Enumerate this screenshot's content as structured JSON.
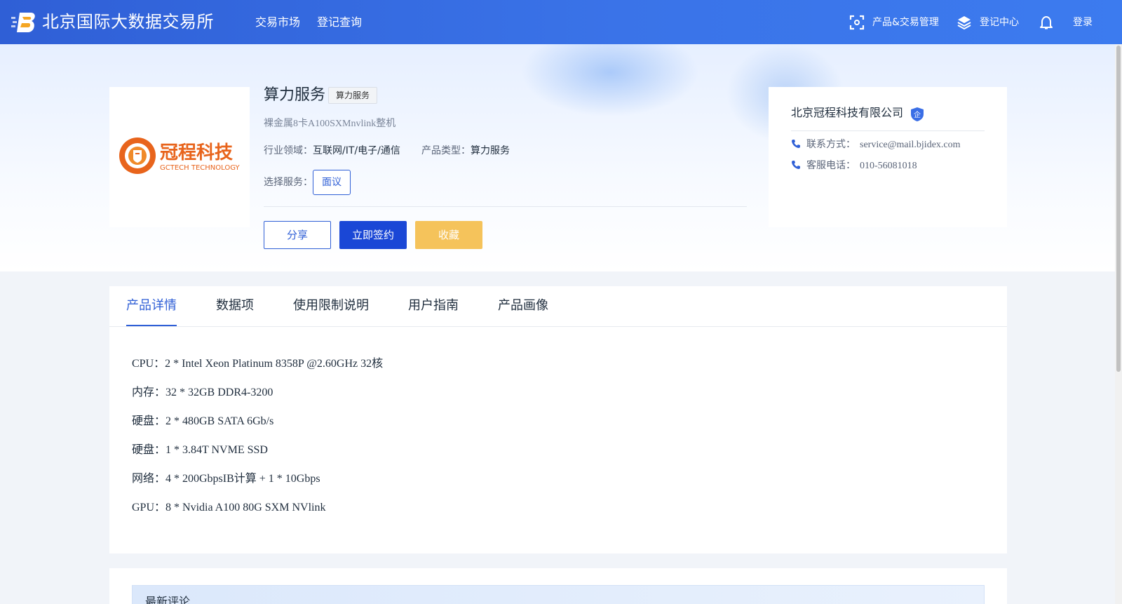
{
  "header": {
    "site_title": "北京国际大数据交易所",
    "nav": [
      "交易市场",
      "登记查询"
    ],
    "product_mgmt": "产品&交易管理",
    "register_center": "登记中心",
    "login": "登录"
  },
  "product": {
    "title": "算力服务",
    "tag": "算力服务",
    "subtitle": "裸金属8卡A100SXMnvlink整机",
    "industry_label": "行业领域：",
    "industry_value": "互联网/IT/电子/通信",
    "type_label": "产品类型：",
    "type_value": "算力服务",
    "service_label": "选择服务：",
    "service_option": "面议",
    "buttons": {
      "share": "分享",
      "sign": "立即签约",
      "favorite": "收藏"
    },
    "logo_text": "冠程科技",
    "logo_subtext": "GCTECH TECHNOLOGY"
  },
  "company": {
    "name": "北京冠程科技有限公司",
    "badge": "企",
    "contact_label": "联系方式：",
    "contact_value": "service@mail.bjidex.com",
    "phone_label": "客服电话：",
    "phone_value": "010-56081018"
  },
  "tabs": [
    "产品详情",
    "数据项",
    "使用限制说明",
    "用户指南",
    "产品画像"
  ],
  "active_tab": "产品详情",
  "specs": [
    "CPU：2 * Intel Xeon Platinum 8358P @2.60GHz 32核",
    "内存：32 * 32GB DDR4-3200",
    "硬盘：2 * 480GB SATA 6Gb/s",
    "硬盘：1 * 3.84T NVME SSD",
    "网络：4 * 200GbpsIB计算 + 1 * 10Gbps",
    "GPU：8 * Nvidia A100 80G SXM NVlink"
  ],
  "comments": {
    "title": "最新评论"
  },
  "colors": {
    "primary": "#2f5fd6",
    "sign_button": "#1a47d6",
    "favorite_button": "#f5c35b"
  }
}
